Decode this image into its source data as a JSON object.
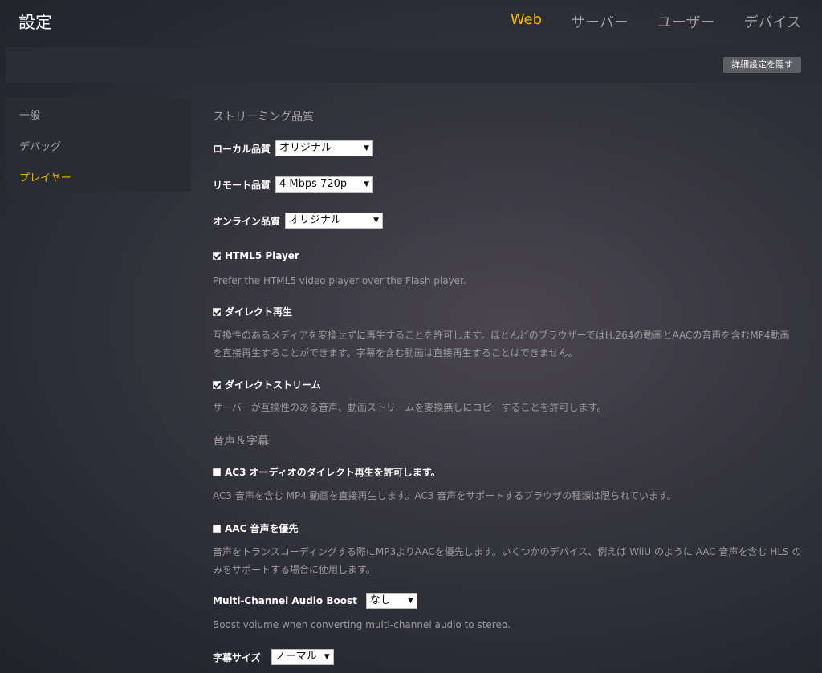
{
  "header": {
    "title": "設定",
    "tabs": [
      {
        "label": "Web",
        "active": true
      },
      {
        "label": "サーバー",
        "active": false
      },
      {
        "label": "ユーザー",
        "active": false
      },
      {
        "label": "デバイス",
        "active": false
      }
    ]
  },
  "subbar": {
    "advanced_button": "詳細設定を隠す"
  },
  "sidebar": {
    "items": [
      {
        "label": "一般",
        "active": false
      },
      {
        "label": "デバッグ",
        "active": false
      },
      {
        "label": "プレイヤー",
        "active": true
      }
    ]
  },
  "streaming": {
    "title": "ストリーミング品質",
    "local_quality": {
      "label": "ローカル品質",
      "value": "オリジナル"
    },
    "remote_quality": {
      "label": "リモート品質",
      "value": "4 Mbps 720p"
    },
    "online_quality": {
      "label": "オンライン品質",
      "value": "オリジナル"
    },
    "html5": {
      "label": "HTML5 Player",
      "checked": true,
      "description": "Prefer the HTML5 video player over the Flash player."
    },
    "direct_play": {
      "label": "ダイレクト再生",
      "checked": true,
      "description_line1": "互換性のあるメディアを変換せずに再生することを許可します。ほとんどのブラウザーではH.264の動画とAACの音声を含むMP4動画",
      "description_line2": "を直接再生することができます。字幕を含む動画は直接再生することはできません。"
    },
    "direct_stream": {
      "label": "ダイレクトストリーム",
      "checked": true,
      "description": "サーバーが互換性のある音声、動画ストリームを変換無しにコピーすることを許可します。"
    }
  },
  "audio": {
    "title": "音声＆字幕",
    "ac3": {
      "label": "AC3 オーディオのダイレクト再生を許可します。",
      "checked": false,
      "description": "AC3 音声を含む MP4 動画を直接再生します。AC3 音声をサポートするブラウザの種類は限られています。"
    },
    "aac": {
      "label": "AAC 音声を優先",
      "checked": false,
      "description_line1": "音声をトランスコーディングする際にMP3よりAACを優先します。いくつかのデバイス、例えば WiiU のように AAC 音声を含む HLS の",
      "description_line2": "みをサポートする場合に使用します。"
    },
    "boost": {
      "label": "Multi-Channel Audio Boost",
      "value": "なし",
      "description": "Boost volume when converting multi-channel audio to stereo."
    },
    "subtitle_size": {
      "label": "字幕サイズ",
      "value": "ノーマル"
    }
  },
  "colors": {
    "accent": "#f5b400",
    "panel": "#2a2c34",
    "button": "#5c5e64"
  },
  "icons": {
    "checkbox_checked": "checkbox-checked-icon",
    "caret": "caret-down-icon"
  }
}
